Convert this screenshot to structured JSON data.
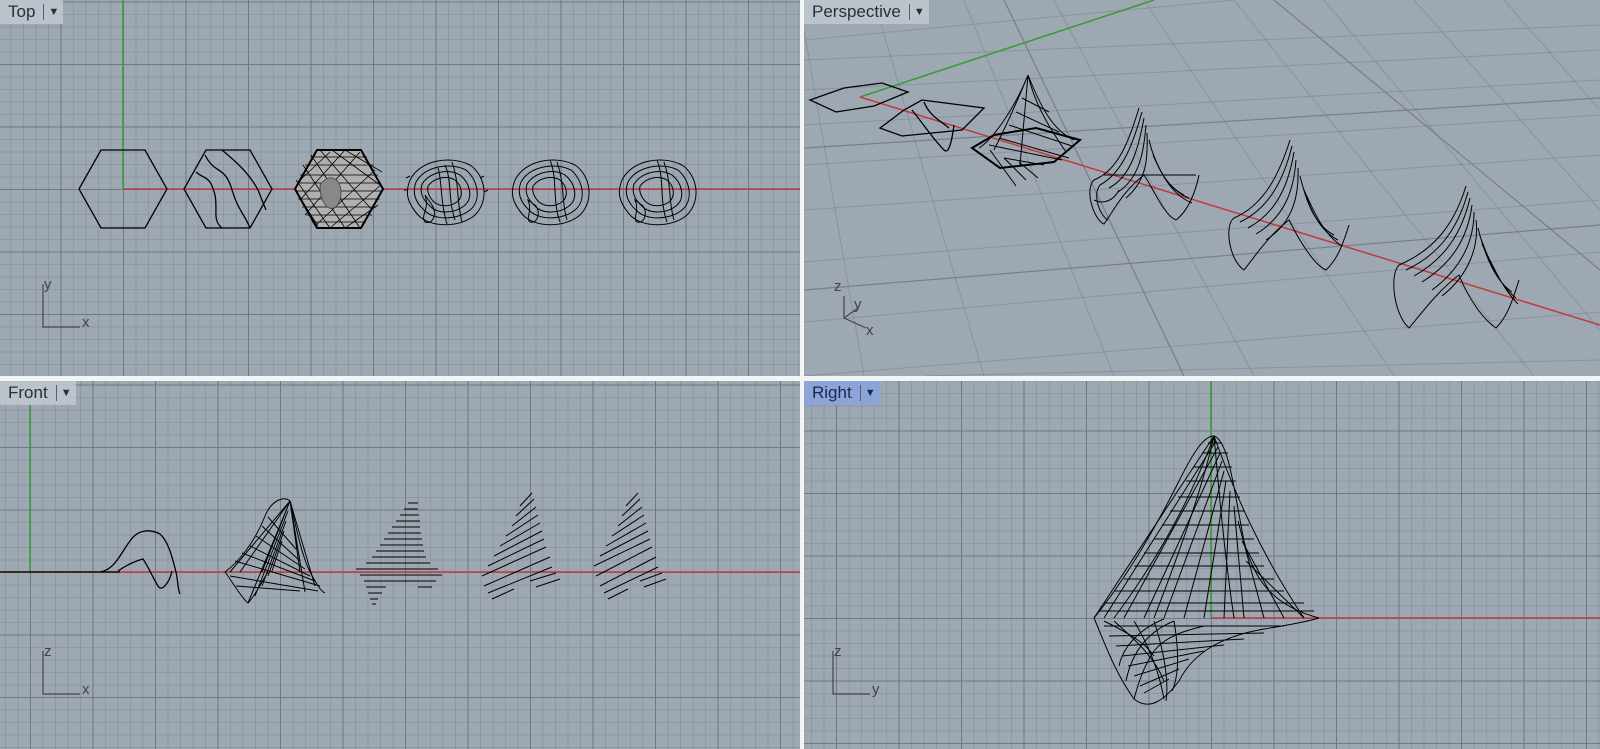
{
  "viewports": {
    "top": {
      "title": "Top",
      "active": false,
      "axis_labels": [
        "y",
        "x"
      ]
    },
    "perspective": {
      "title": "Perspective",
      "active": false,
      "axis_labels": [
        "z",
        "y",
        "x"
      ]
    },
    "front": {
      "title": "Front",
      "active": false,
      "axis_labels": [
        "z",
        "x"
      ]
    },
    "right": {
      "title": "Right",
      "active": true,
      "axis_labels": [
        "z",
        "y"
      ]
    }
  },
  "icons": {
    "viewport_menu": "chevron-down-icon"
  },
  "colors": {
    "background": "#9ea8b3",
    "active_title": "#8da4d9",
    "x_axis": "#c23a3a",
    "y_axis": "#3a9a3a",
    "geometry": "#000000"
  }
}
